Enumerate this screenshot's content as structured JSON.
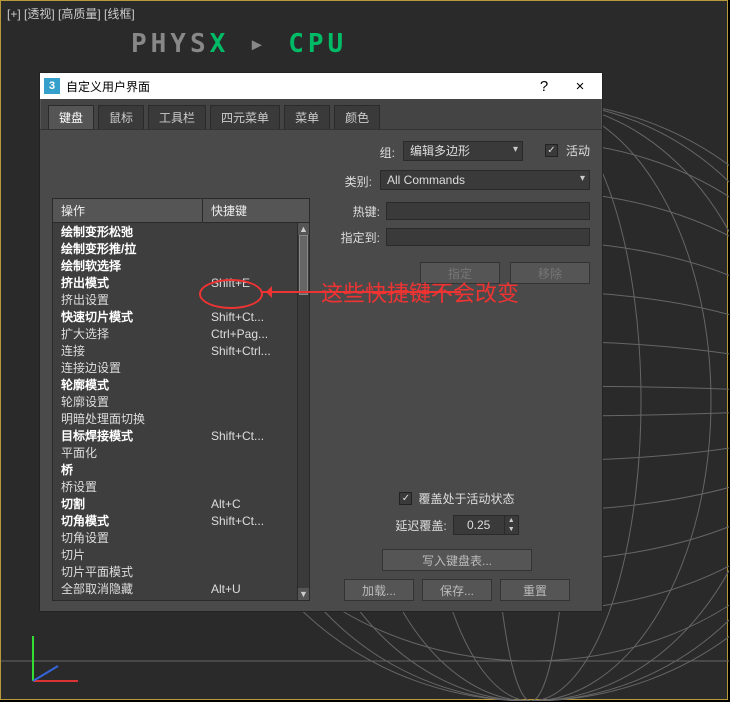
{
  "viewport_label": "[+] [透视] [高质量] [线框]",
  "physx": {
    "p1": "PHYS",
    "x": "X ",
    "arrow": "▸ ",
    "p2": "CPU"
  },
  "dialog": {
    "title": "自定义用户界面",
    "help": "?",
    "close": "×",
    "tabs": [
      "键盘",
      "鼠标",
      "工具栏",
      "四元菜单",
      "菜单",
      "颜色"
    ],
    "active_tab": 0,
    "group_label": "组:",
    "group_value": "编辑多边形",
    "active_checkbox_label": "活动",
    "active_checked": true,
    "category_label": "类别:",
    "category_value": "All Commands",
    "list_headers": {
      "action": "操作",
      "shortcut": "快捷键"
    },
    "rows": [
      {
        "action": "绘制变形松弛",
        "shortcut": "",
        "bold": true
      },
      {
        "action": "绘制变形推/拉",
        "shortcut": "",
        "bold": true
      },
      {
        "action": "绘制软选择",
        "shortcut": "",
        "bold": true
      },
      {
        "action": "挤出模式",
        "shortcut": "Shift+E",
        "bold": true
      },
      {
        "action": "挤出设置",
        "shortcut": "",
        "bold": false
      },
      {
        "action": "快速切片模式",
        "shortcut": "Shift+Ct...",
        "bold": true
      },
      {
        "action": "扩大选择",
        "shortcut": "Ctrl+Pag...",
        "bold": false
      },
      {
        "action": "连接",
        "shortcut": "Shift+Ctrl...",
        "bold": false
      },
      {
        "action": "连接边设置",
        "shortcut": "",
        "bold": false
      },
      {
        "action": "轮廓模式",
        "shortcut": "",
        "bold": true
      },
      {
        "action": "轮廓设置",
        "shortcut": "",
        "bold": false
      },
      {
        "action": "明暗处理面切换",
        "shortcut": "",
        "bold": false
      },
      {
        "action": "目标焊接模式",
        "shortcut": "Shift+Ct...",
        "bold": true
      },
      {
        "action": "平面化",
        "shortcut": "",
        "bold": false
      },
      {
        "action": "桥",
        "shortcut": "",
        "bold": true
      },
      {
        "action": "桥设置",
        "shortcut": "",
        "bold": false
      },
      {
        "action": "切割",
        "shortcut": "Alt+C",
        "bold": true
      },
      {
        "action": "切角模式",
        "shortcut": "Shift+Ct...",
        "bold": true
      },
      {
        "action": "切角设置",
        "shortcut": "",
        "bold": false
      },
      {
        "action": "切片",
        "shortcut": "",
        "bold": false
      },
      {
        "action": "切片平面模式",
        "shortcut": "",
        "bold": false
      },
      {
        "action": "全部取消隐藏",
        "shortcut": "Alt+U",
        "bold": false
      }
    ],
    "hotkey_label": "热键:",
    "assigned_label": "指定到:",
    "assign_btn": "指定",
    "remove_btn": "移除",
    "override_chk_label": "覆盖处于活动状态",
    "override_checked": true,
    "delay_label": "延迟覆盖:",
    "delay_value": "0.25",
    "write_btn": "写入键盘表...",
    "load_btn": "加载...",
    "save_btn": "保存...",
    "reset_btn": "重置"
  },
  "annotation_text": "这些快捷键不会改变"
}
